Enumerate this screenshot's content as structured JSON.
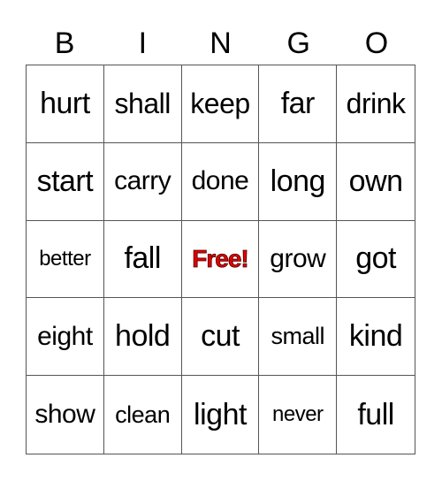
{
  "header": [
    "B",
    "I",
    "N",
    "G",
    "O"
  ],
  "free_label": "Free!",
  "colors": {
    "free_text": "#e00000",
    "grid_line": "#555555"
  },
  "cells": [
    [
      "hurt",
      "shall",
      "keep",
      "far",
      "drink"
    ],
    [
      "start",
      "carry",
      "done",
      "long",
      "own"
    ],
    [
      "better",
      "fall",
      "Free!",
      "grow",
      "got"
    ],
    [
      "eight",
      "hold",
      "cut",
      "small",
      "kind"
    ],
    [
      "show",
      "clean",
      "light",
      "never",
      "full"
    ]
  ]
}
